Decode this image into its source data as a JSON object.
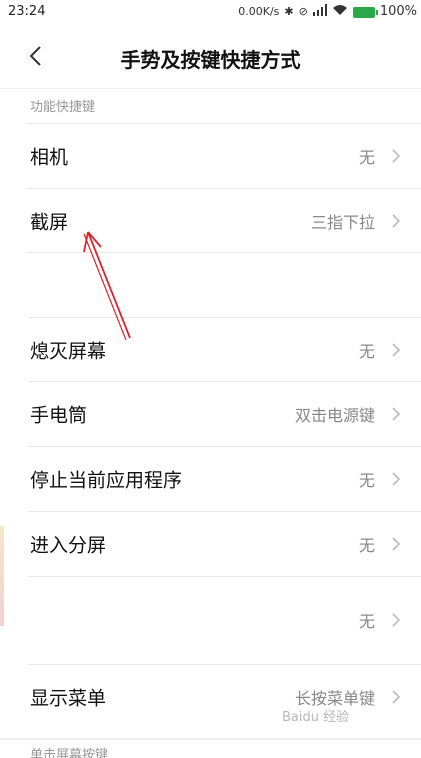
{
  "status_bar": {
    "time": "23:24",
    "network_speed": "0.00K/s",
    "battery": "100%",
    "icons": [
      "bluetooth-icon",
      "alarm-off-icon",
      "signal-icon",
      "wifi-icon",
      "battery-icon"
    ]
  },
  "header": {
    "back_icon": "chevron-left-icon",
    "title": "手势及按键快捷方式"
  },
  "sections": {
    "function_shortcuts_label": "功能快捷键",
    "single_tap_label": "单击屏幕按键"
  },
  "rows": [
    {
      "label": "相机",
      "value": "无"
    },
    {
      "label": "截屏",
      "value": "三指下拉"
    },
    {
      "label": "",
      "value": ""
    },
    {
      "label": "熄灭屏幕",
      "value": "无"
    },
    {
      "label": "手电筒",
      "value": "双击电源键"
    },
    {
      "label": "停止当前应用程序",
      "value": "无"
    },
    {
      "label": "进入分屏",
      "value": "无"
    },
    {
      "label": "",
      "value": "无"
    },
    {
      "label": "显示菜单",
      "value": "长按菜单键"
    }
  ],
  "watermark": "Baidu 经验",
  "colors": {
    "annotation_arrow": "#d9232e",
    "secondary_text": "#888888",
    "battery": "#2aa84a"
  }
}
